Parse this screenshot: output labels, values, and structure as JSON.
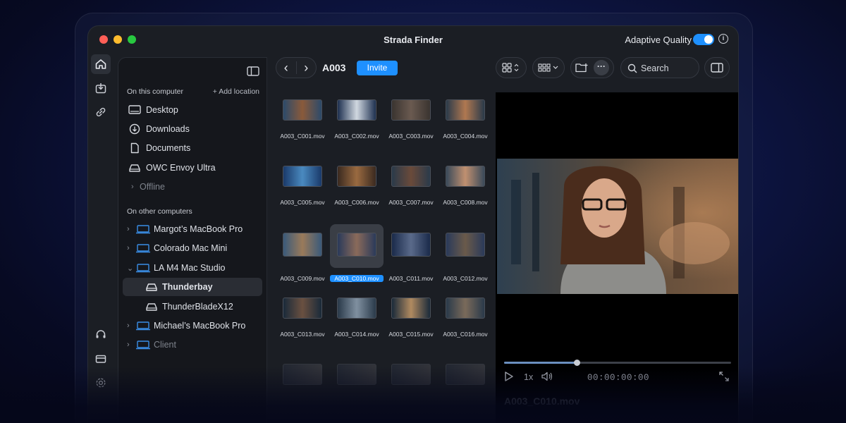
{
  "window": {
    "title": "Strada Finder",
    "adaptive_quality_label": "Adaptive Quality",
    "adaptive_quality_on": true,
    "accent": "#1e90ff"
  },
  "rail": {
    "icons": [
      "home-icon",
      "import-icon",
      "link-icon",
      "support-icon",
      "billing-icon",
      "settings-icon"
    ]
  },
  "sidebar": {
    "on_this_computer": "On this computer",
    "add_location": "Add location",
    "local_items": [
      {
        "label": "Desktop",
        "icon": "desktop-icon"
      },
      {
        "label": "Downloads",
        "icon": "download-icon"
      },
      {
        "label": "Documents",
        "icon": "document-icon"
      },
      {
        "label": "OWC Envoy Ultra",
        "icon": "drive-icon"
      }
    ],
    "offline_label": "Offline",
    "on_other_computers": "On other computers",
    "remote_items": [
      {
        "label": "Margot’s MacBook Pro",
        "icon": "laptop-icon"
      },
      {
        "label": "Colorado Mac Mini",
        "icon": "laptop-icon"
      },
      {
        "label": "LA M4 Mac Studio",
        "icon": "laptop-icon"
      }
    ],
    "drives": [
      {
        "label": "Thunderbay",
        "icon": "drive-icon",
        "selected": true
      },
      {
        "label": "ThunderBladeX12",
        "icon": "drive-icon"
      }
    ],
    "more_items": [
      {
        "label": "Michael’s MacBook Pro",
        "icon": "laptop-icon"
      },
      {
        "label": "Client",
        "icon": "laptop-icon"
      }
    ]
  },
  "toolbar": {
    "folder_title": "A003",
    "invite_label": "Invite",
    "search_placeholder": "Search"
  },
  "files": [
    "A003_C001.mov",
    "A003_C002.mov",
    "A003_C003.mov",
    "A003_C004.mov",
    "A003_C005.mov",
    "A003_C006.mov",
    "A003_C007.mov",
    "A003_C008.mov",
    "A003_C009.mov",
    "A003_C010.mov",
    "A003_C011.mov",
    "A003_C012.mov",
    "A003_C013.mov",
    "A003_C014.mov",
    "A003_C015.mov",
    "A003_C016.mov"
  ],
  "selected_file": "A003_C010.mov",
  "player": {
    "speed": "1x",
    "timecode": "00:00:00:00",
    "progress": 0.32,
    "file_name": "A003_C010.mov"
  }
}
